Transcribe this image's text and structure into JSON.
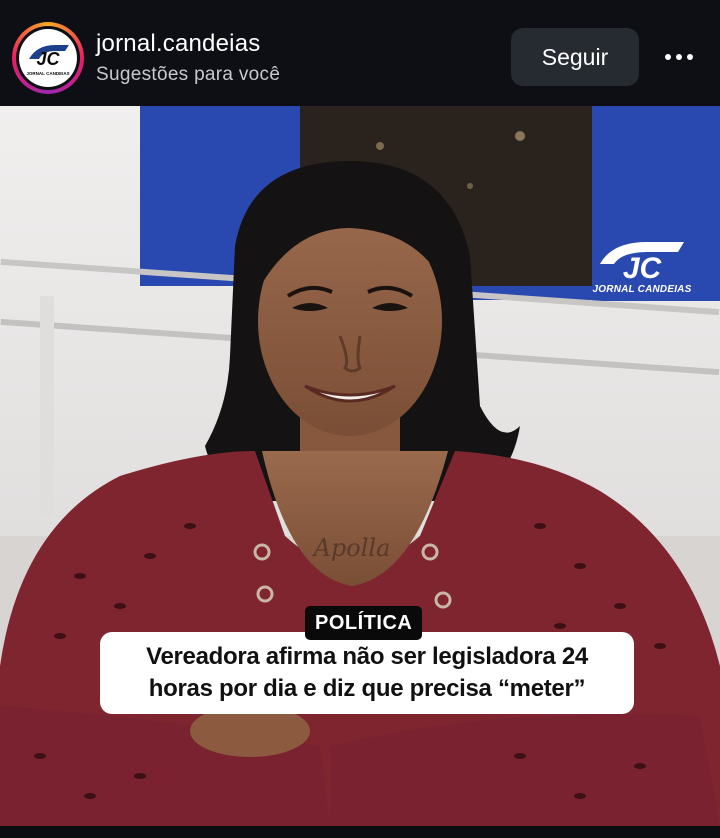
{
  "post": {
    "account_name": "jornal.candeias",
    "subtitle": "Sugestões para você",
    "follow_label": "Seguir",
    "more_icon": "more-options-icon",
    "avatar_logo_text": "JC",
    "avatar_logo_caption": "JORNAL CANDEIAS"
  },
  "image": {
    "watermark_logo": "JC",
    "watermark_text": "JORNAL CANDEIAS",
    "tattoo_text": "Apolla",
    "category": "POLÍTICA",
    "headline": "Vereadora afirma não ser legisladora 24\nhoras por dia e diz que precisa “meter”"
  },
  "colors": {
    "header_bg": "#0d0f14",
    "follow_bg": "#262a31",
    "shutter_blue": "#2a49b0",
    "blouse": "#7e2530",
    "tag_bg": "#0a0a0a",
    "headline_bg": "#ffffff"
  }
}
